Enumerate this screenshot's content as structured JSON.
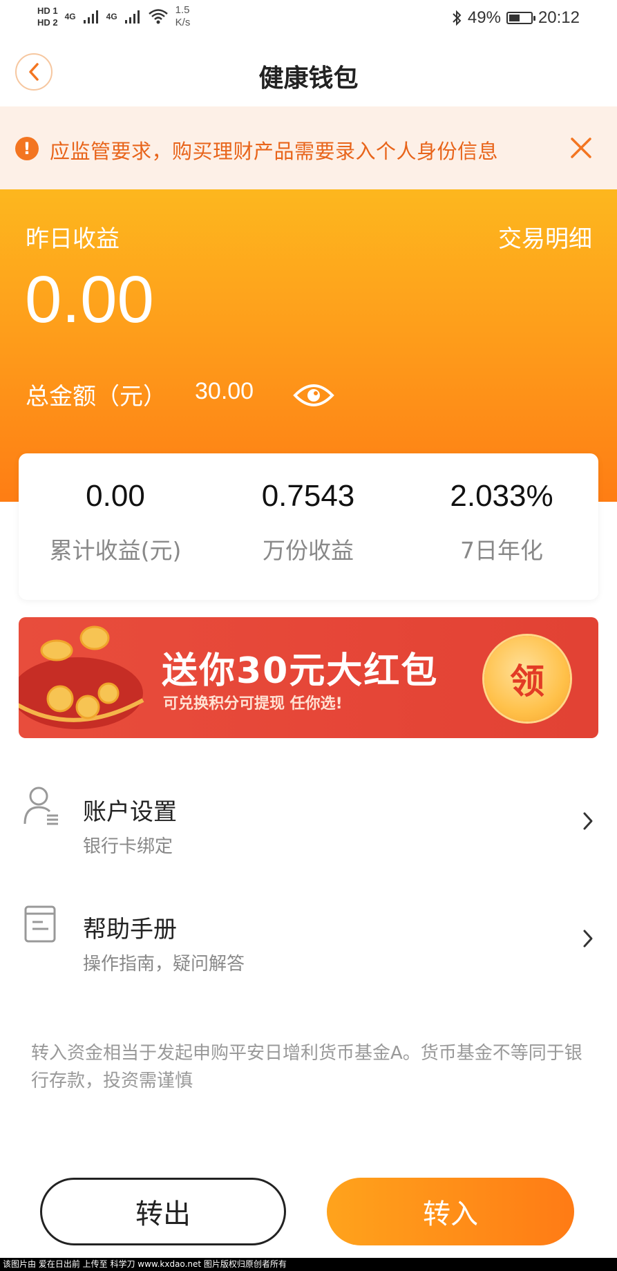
{
  "status_bar": {
    "hd1": "HD 1",
    "hd2": "HD 2",
    "network1": "4G",
    "network2": "4G",
    "speed_value": "1.5",
    "speed_unit": "K/s",
    "battery_percent": "49%",
    "battery_level": 0.49,
    "time": "20:12"
  },
  "header": {
    "title": "健康钱包",
    "back_icon": "chevron-left-icon"
  },
  "notice": {
    "text": "应监管要求，购买理财产品需要录入个人身份信息",
    "icon": "alert-icon",
    "close_icon": "close-icon"
  },
  "hero": {
    "yesterday_label": "昨日收益",
    "detail_link": "交易明细",
    "yesterday_value": "0.00",
    "total_label": "总金额（元）",
    "total_value": "30.00",
    "eye_icon": "eye-icon"
  },
  "stats": [
    {
      "value": "0.00",
      "label": "累计收益(元)"
    },
    {
      "value": "0.7543",
      "label": "万份收益"
    },
    {
      "value": "2.033%",
      "label": "7日年化"
    }
  ],
  "banner": {
    "title": "送你30元大红包",
    "subtitle": "可兑换积分可提现 任你选!",
    "claim_label": "领"
  },
  "menu": [
    {
      "title": "账户设置",
      "subtitle": "银行卡绑定",
      "icon": "user-settings-icon"
    },
    {
      "title": "帮助手册",
      "subtitle": "操作指南，疑问解答",
      "icon": "manual-icon"
    }
  ],
  "disclaimer": "转入资金相当于发起申购平安日增利货币基金A。货币基金不等同于银行存款，投资需谨慎",
  "actions": {
    "transfer_out": "转出",
    "transfer_in": "转入"
  },
  "watermark": "该图片由 爱在日出前 上传至 科学刀 www.kxdao.net 图片版权归原创者所有",
  "colors": {
    "accent": "#fe8a18",
    "notice_bg": "#fdf0e7",
    "notice_text": "#e8641a",
    "banner_red": "#e64738"
  }
}
